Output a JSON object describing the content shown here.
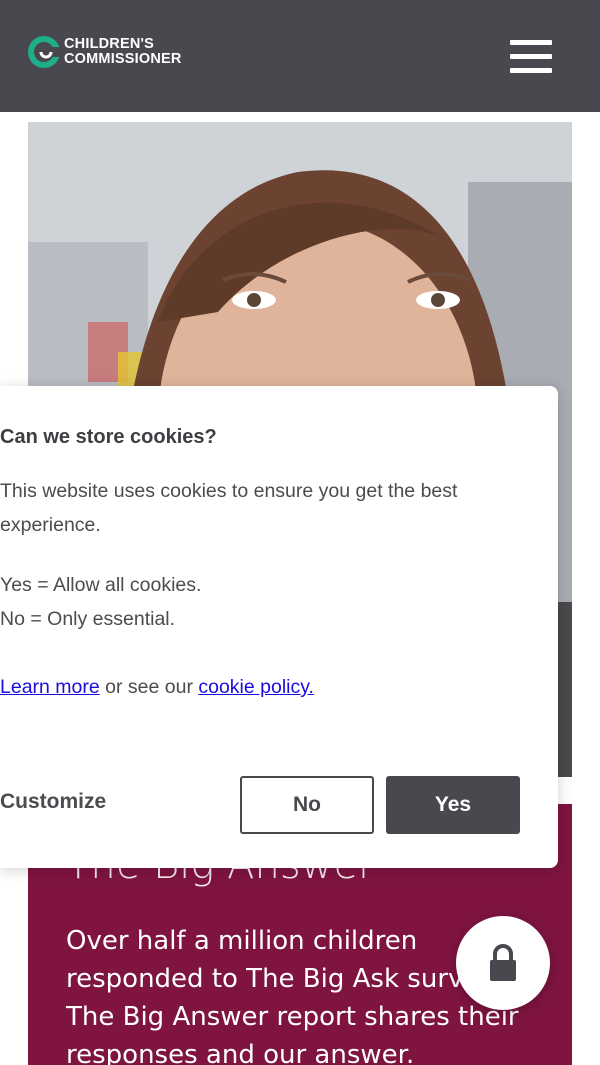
{
  "header": {
    "logo_line1": "CHILDREN'S",
    "logo_line2": "COMMISSIONER",
    "menu_icon": "hamburger-menu-icon"
  },
  "panel": {
    "title": "The Big Answer",
    "body": "Over half a million children responded to The Big Ask survey. The Big Answer report shares their responses and our answer."
  },
  "cookie": {
    "title": "Can we store cookies?",
    "description": "This website uses cookies to ensure you get the best experience.",
    "yes_line": "Yes = Allow all cookies.",
    "no_line": "No = Only essential.",
    "learn_more": "Learn more",
    "or_see": " or see our ",
    "policy_link": "cookie policy.",
    "customize": "Customize",
    "no_button": "No",
    "yes_button": "Yes"
  },
  "floating": {
    "icon": "lock-icon"
  },
  "colors": {
    "header": "#48484e",
    "panel": "#7f1440",
    "accent": "#1fae8a",
    "link": "#1a0dde"
  }
}
